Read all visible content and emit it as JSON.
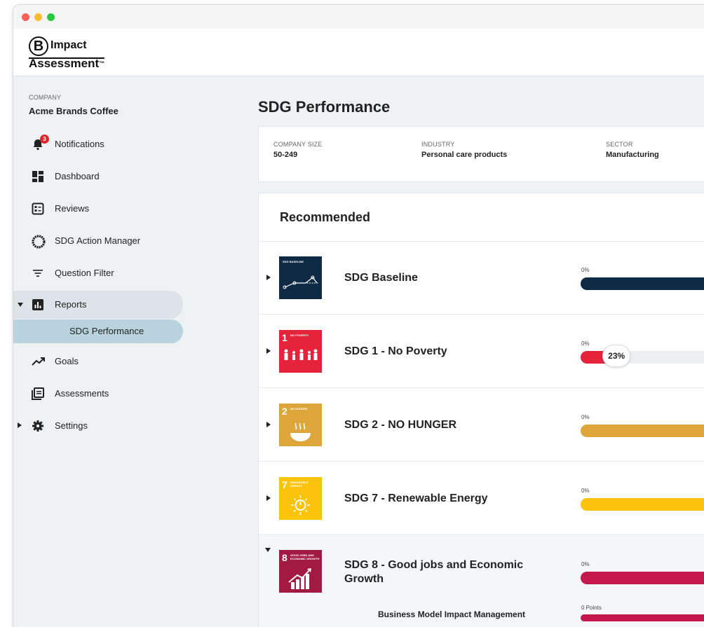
{
  "window": {
    "controls": [
      "close",
      "minimize",
      "maximize"
    ]
  },
  "brand": {
    "logo_letter": "B",
    "line1": "Impact",
    "line2": "Assessment",
    "trademark": "™"
  },
  "sidebar": {
    "company_label": "COMPANY",
    "company_name": "Acme Brands Coffee",
    "items": [
      {
        "label": "Notifications",
        "icon": "bell-icon",
        "badge": "3"
      },
      {
        "label": "Dashboard",
        "icon": "dashboard-icon"
      },
      {
        "label": "Reviews",
        "icon": "reviews-icon"
      },
      {
        "label": "SDG Action Manager",
        "icon": "sdg-wheel-icon"
      },
      {
        "label": "Question Filter",
        "icon": "filter-icon"
      },
      {
        "label": "Reports",
        "icon": "reports-icon",
        "expanded": true
      },
      {
        "label": "Goals",
        "icon": "trend-icon"
      },
      {
        "label": "Assessments",
        "icon": "assessments-icon"
      },
      {
        "label": "Settings",
        "icon": "gear-icon",
        "expanded": false
      }
    ],
    "sub_item": "SDG Performance"
  },
  "main": {
    "title": "SDG Performance",
    "info": [
      {
        "key": "COMPANY SIZE",
        "value": "50-249"
      },
      {
        "key": "INDUSTRY",
        "value": "Personal care products"
      },
      {
        "key": "SECTOR",
        "value": "Manufacturing"
      }
    ],
    "recommended_title": "Recommended",
    "sdgs": [
      {
        "name": "SDG Baseline",
        "tile_num": "",
        "tile_label": "SDG BASELINE",
        "color": "#0f2a45",
        "bar_label": "0%",
        "fill": 1.0,
        "bubble": null
      },
      {
        "name": "SDG 1 - No Poverty",
        "tile_num": "1",
        "tile_label": "NO POVERTY",
        "color": "#e5243b",
        "bar_label": "0%",
        "fill": 0.23,
        "bubble": "23%"
      },
      {
        "name": "SDG 2 - NO HUNGER",
        "tile_num": "2",
        "tile_label": "NO HUNGER",
        "color": "#dda63a",
        "bar_label": "0%",
        "fill": 1.0,
        "bubble": null
      },
      {
        "name": "SDG 7 - Renewable Energy",
        "tile_num": "7",
        "tile_label": "RENEWABLE ENERGY",
        "color": "#fcc30b",
        "bar_label": "0%",
        "fill": 1.0,
        "bubble": null
      },
      {
        "name": "SDG 8 - Good jobs and Economic Growth",
        "tile_num": "8",
        "tile_label": "GOOD JOBS AND ECONOMIC GROWTH",
        "color": "#a21942",
        "bar_label": "0%",
        "fill": 1.0,
        "bubble": null,
        "expanded": true,
        "bar_color": "#c5194d"
      }
    ],
    "sub_item": {
      "name": "Business Model Impact Management",
      "label": "0 Points"
    }
  }
}
